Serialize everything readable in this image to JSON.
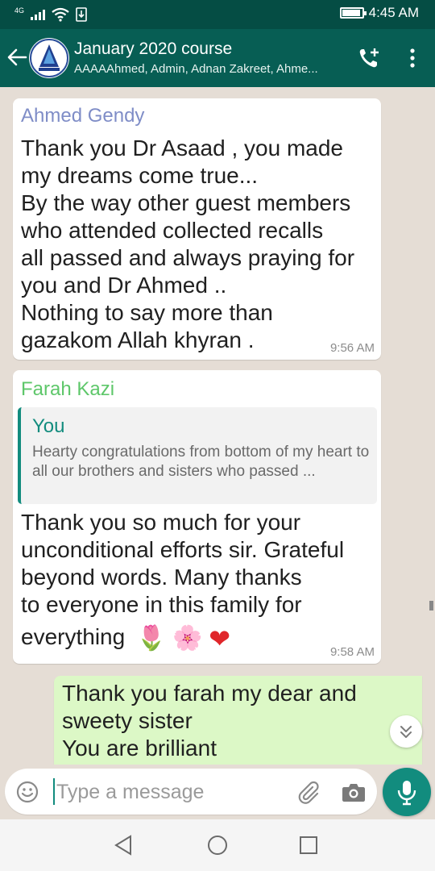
{
  "status_bar": {
    "network_type": "4G",
    "time": "4:45 AM",
    "battery_level": 0.95
  },
  "header": {
    "title": "January 2020 course",
    "subtitle": "AAAAAhmed, Admin, Adnan Zakreet, Ahme...",
    "avatar_icon": "group-logo-icon",
    "call_icon": "add-call-icon",
    "menu_icon": "overflow-menu-icon"
  },
  "messages": [
    {
      "sender": "Ahmed Gendy",
      "sender_color": "#7f8dc7",
      "lines": [
        "Thank you Dr Asaad , you made",
        "my dreams come true...",
        "By the way other guest members",
        "who attended collected recalls",
        "all passed and always praying for",
        "you and Dr Ahmed ..",
        "Nothing to say more than",
        "gazakom Allah khyran ."
      ],
      "time": "9:56 AM"
    },
    {
      "sender": "Farah Kazi",
      "sender_color": "#5ec76a",
      "quote": {
        "author": "You",
        "text": "Hearty congratulations from bottom of my heart to all our brothers and sisters who passed ..."
      },
      "lines": [
        "Thank you so much for your",
        "unconditional efforts sir. Grateful",
        "beyond words. Many thanks",
        "to everyone in this family for"
      ],
      "last_line": "everything",
      "emojis": [
        "🌷",
        "🌸",
        "❤"
      ],
      "time": "9:58 AM"
    },
    {
      "sender": "",
      "lines": [
        "Thank you farah  my dear and",
        "sweety sister",
        "You are brilliant"
      ]
    }
  ],
  "input": {
    "placeholder": "Type a message"
  },
  "colors": {
    "header": "#075e54",
    "status": "#054d44",
    "accent": "#128c7e",
    "outgoing_bubble": "#dcf8c6",
    "background": "#e5ddd5"
  }
}
